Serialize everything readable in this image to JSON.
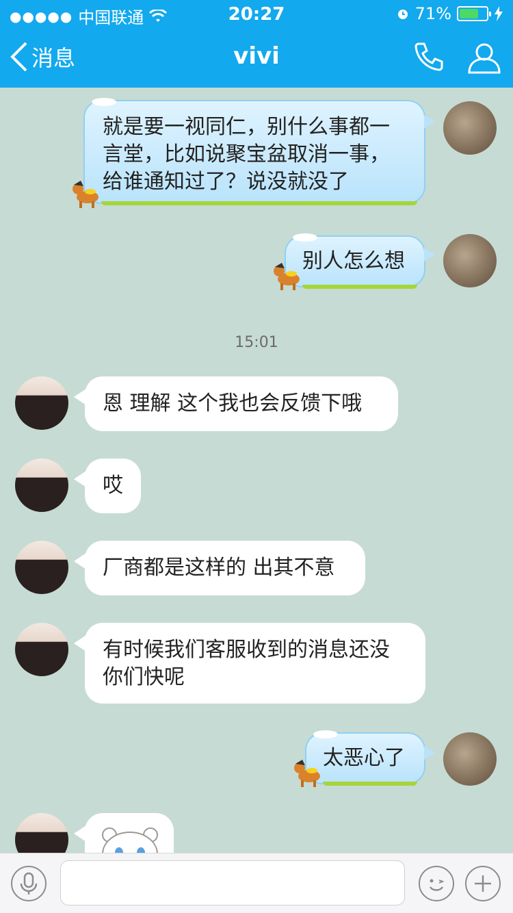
{
  "status": {
    "carrier": "中国联通",
    "time": "20:27",
    "battery_percent_text": "71%",
    "battery_level": 0.71
  },
  "nav": {
    "back_label": "消息",
    "title": "vivi"
  },
  "messages": [
    {
      "side": "out",
      "text": "就是要一视同仁，别什么事都一言堂，比如说聚宝盆取消一事，给谁通知过了？说没就没了"
    },
    {
      "side": "out",
      "text": "别人怎么想"
    },
    {
      "side": "in",
      "text": "恩 理解 这个我也会反馈下哦"
    },
    {
      "side": "in",
      "text": "哎"
    },
    {
      "side": "in",
      "text": "厂商都是这样的 出其不意"
    },
    {
      "side": "in",
      "text": "有时候我们客服收到的消息还没你们快呢"
    },
    {
      "side": "out",
      "text": "太恶心了"
    }
  ],
  "timestamp": "15:01",
  "colors": {
    "nav_bg": "#12a9ee",
    "chat_bg": "#c6dbd3",
    "bubble_out": "#b9e3fb",
    "bubble_in": "#ffffff"
  }
}
